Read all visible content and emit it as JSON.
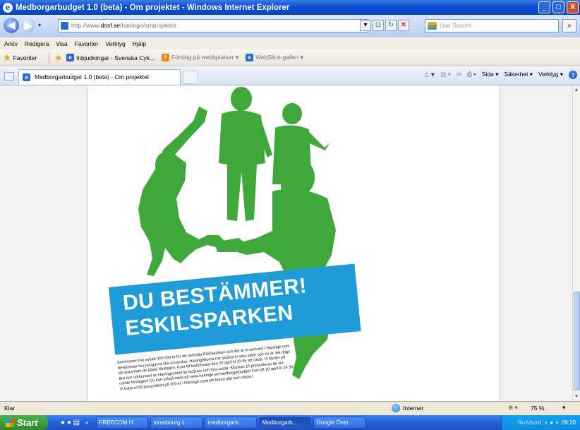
{
  "window": {
    "title": "Medborgarbudget 1.0 (beta) - Om projektet - Windows Internet Explorer",
    "controls": {
      "minimize": "_",
      "maximize": "□",
      "close": "X"
    }
  },
  "address_bar": {
    "url_prefix": "http://www.",
    "url_domain": "dosf.se",
    "url_path": "/haninge/omprojektet",
    "search_placeholder": "Live Search"
  },
  "menu": [
    "Arkiv",
    "Redigera",
    "Visa",
    "Favoriter",
    "Verktyg",
    "Hjälp"
  ],
  "favorites_bar": {
    "favorites_label": "Favoriter",
    "items": [
      "Inbjudningar - Svenska Cyk...",
      "Förslag på webbplatser ▾",
      "WebSlice-galleri ▾"
    ]
  },
  "tab": {
    "label": "Medborgarbudget 1.0 (beta) - Om projektet"
  },
  "command_bar": {
    "sida": "Sida ▾",
    "sakerhet": "Säkerhet ▾",
    "verktyg": "Verktyg ▾"
  },
  "poster": {
    "headline_1": "DU BESTÄMMER!",
    "headline_2": "ESKILSPARKEN",
    "body_lines": [
      "Kommunen har avsatt 400 000 kr för att utveckla Eskilsparken och det är ni som bor i Haninge som",
      "bestämmer hur pengarna ska användas. Haningeborna har skickat in sina idéer och nu är det dags",
      "att rösta fram de bästa förslagen. Kom till kulturhuset den 25 april kl 13 för att rösta. Vi bjuder på",
      "fika och värkonsert av Haningesönerna AcQuire och Fria rustar. Klockan 15 presenteras de vin-",
      "nande förslagen! Du kan också rösta på www.haninge.se/medborgarbudget fram till 29 april kl 14:30.",
      "Vi lottar ut 50 presentkort på 200 kr i Haninge centrum bland alla som röstar!"
    ],
    "colors": {
      "green": "#3ea83a",
      "blue": "#1f9bd7"
    }
  },
  "status_bar": {
    "status": "Klar",
    "zone": "Internet",
    "zoom": "75 %"
  },
  "taskbar": {
    "start": "Start",
    "buttons": [
      "FREECOM H...",
      "strasbourg z...",
      "medborgarb...",
      "Medborgarb...",
      "Google Över..."
    ],
    "tray_text": "Skrivbord",
    "clock": "09:20"
  }
}
